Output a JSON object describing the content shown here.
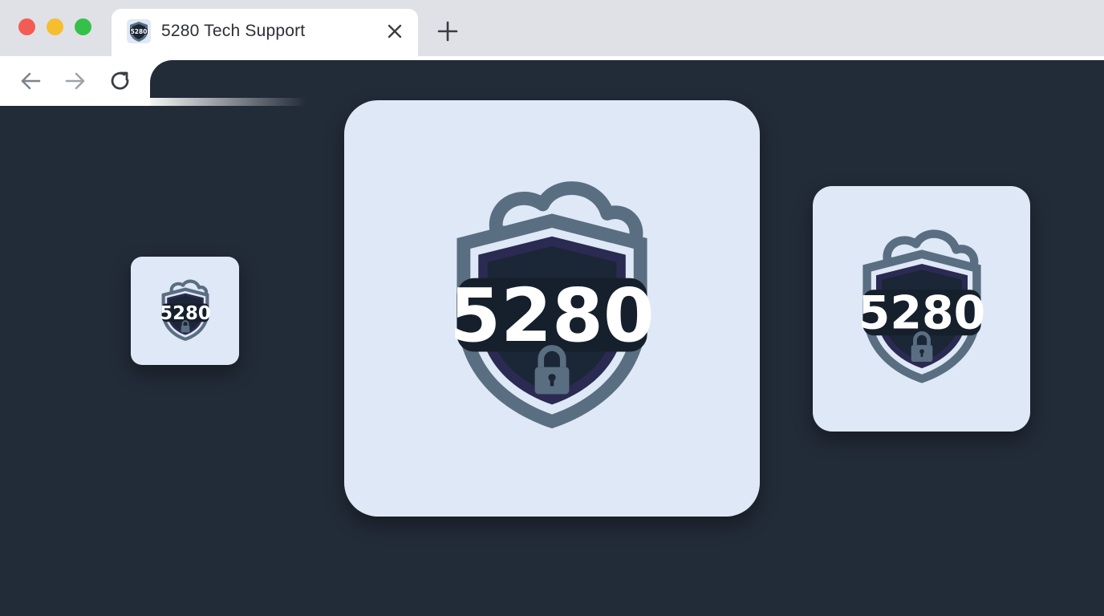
{
  "window": {
    "traffic_lights": [
      "close",
      "minimize",
      "zoom"
    ]
  },
  "tab": {
    "title": "5280 Tech Support",
    "favicon_text": "5280",
    "favicon_icon": "shield-logo-icon",
    "close_icon": "close-icon"
  },
  "toolbar": {
    "back_icon": "arrow-left-icon",
    "forward_icon": "arrow-right-icon",
    "reload_icon": "reload-icon",
    "new_tab_icon": "plus-icon"
  },
  "logos": {
    "small": {
      "text": "5280",
      "icon": "shield-cloud-lock-icon"
    },
    "large": {
      "text": "5280",
      "icon": "shield-cloud-lock-icon"
    },
    "medium": {
      "text": "5280",
      "icon": "shield-cloud-lock-icon"
    }
  },
  "colors": {
    "page_background": "#222b38",
    "card_background": "#dfe8f6",
    "shield_outer": "#5a6e82",
    "shield_inner": "#2b2a52",
    "shield_dark": "#1b2636",
    "banner": "#16202c",
    "number_text": "#ffffff",
    "lock": "#5a6e82"
  }
}
